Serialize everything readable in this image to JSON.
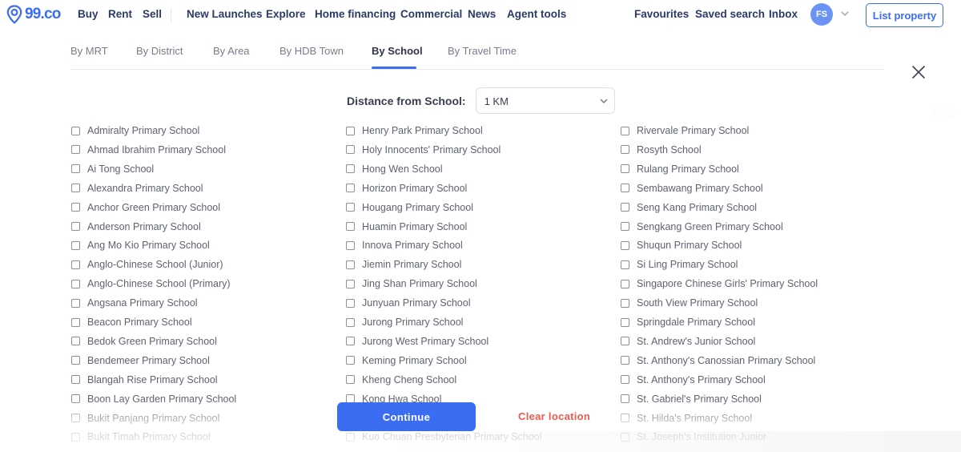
{
  "brand": {
    "logo_text": "99.co",
    "accent_color": "#3b6df2",
    "danger_color": "#ef5a4f"
  },
  "navbar": {
    "left_items": [
      "Buy",
      "Rent",
      "Sell"
    ],
    "main_items": [
      "New Launches",
      "Explore",
      "Home financing",
      "Commercial",
      "News",
      "Agent tools"
    ],
    "right_items": [
      "Favourites",
      "Saved search",
      "Inbox"
    ],
    "avatar_initials": "FS",
    "list_property_label": "List property"
  },
  "modal": {
    "tabs": [
      {
        "label": "By MRT",
        "active": false
      },
      {
        "label": "By District",
        "active": false
      },
      {
        "label": "By Area",
        "active": false
      },
      {
        "label": "By HDB Town",
        "active": false
      },
      {
        "label": "By School",
        "active": true
      },
      {
        "label": "By Travel Time",
        "active": false
      }
    ],
    "distance_label": "Distance from School:",
    "distance_value": "1 KM",
    "continue_label": "Continue",
    "clear_label": "Clear location",
    "columns": [
      [
        "Admiralty Primary School",
        "Ahmad Ibrahim Primary School",
        "Ai Tong School",
        "Alexandra Primary School",
        "Anchor Green Primary School",
        "Anderson Primary School",
        "Ang Mo Kio Primary School",
        "Anglo-Chinese School (Junior)",
        "Anglo-Chinese School (Primary)",
        "Angsana Primary School",
        "Beacon Primary School",
        "Bedok Green Primary School",
        "Bendemeer Primary School",
        "Blangah Rise Primary School",
        "Boon Lay Garden Primary School",
        "Bukit Panjang Primary School",
        "Bukit Timah Primary School"
      ],
      [
        "Henry Park Primary School",
        "Holy Innocents' Primary School",
        "Hong Wen School",
        "Horizon Primary School",
        "Hougang Primary School",
        "Huamin Primary School",
        "Innova Primary School",
        "Jiemin Primary School",
        "Jing Shan Primary School",
        "Junyuan Primary School",
        "Jurong Primary School",
        "Jurong West Primary School",
        "Keming Primary School",
        "Kheng Cheng School",
        "Kong Hwa School",
        "",
        "Kuo Chuan Presbyterian Primary School"
      ],
      [
        "Rivervale Primary School",
        "Rosyth School",
        "Rulang Primary School",
        "Sembawang Primary School",
        "Seng Kang Primary School",
        "Sengkang Green Primary School",
        "Shuqun Primary School",
        "Si Ling Primary School",
        "Singapore Chinese Girls' Primary School",
        "South View Primary School",
        "Springdale Primary School",
        "St. Andrew's Junior School",
        "St. Anthony's Canossian Primary School",
        "St. Anthony's Primary School",
        "St. Gabriel's Primary School",
        "St. Hilda's Primary School",
        "St. Joseph's Institution Junior"
      ]
    ]
  }
}
